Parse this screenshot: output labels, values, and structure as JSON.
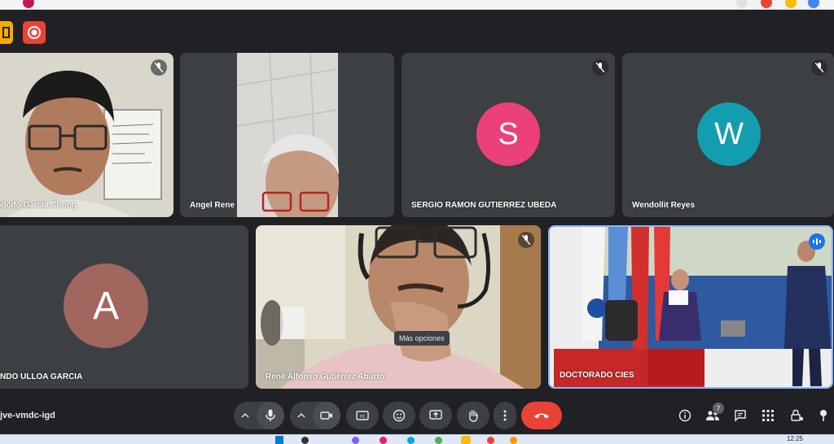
{
  "browser": {
    "url": ""
  },
  "meeting": {
    "code": "jve-vmdc-igd",
    "participant_count": "7"
  },
  "tiles": {
    "rodolfo": {
      "name": "Rodolfo García Chong"
    },
    "angel": {
      "name": "Angel Rene"
    },
    "sergio": {
      "name": "SERGIO RAMON GUTIERREZ UBEDA",
      "initial": "S",
      "avatar_color": "#ec407a"
    },
    "wendollit": {
      "name": "Wendollit Reyes",
      "initial": "W",
      "avatar_color": "#129eaf"
    },
    "ulloa": {
      "name": "NDO ULLOA GARCIA",
      "initial": "A",
      "avatar_color": "#a1665e"
    },
    "rene": {
      "name": "René Alfonso Gutiérrez Aburto"
    },
    "doctorado": {
      "name": "DOCTORADO CIES"
    }
  },
  "tooltip": {
    "text": "Más opciones"
  },
  "taskbar": {
    "time": "12:25"
  },
  "colors": {
    "tile": "#3c4043",
    "bg": "#202124",
    "accent": "#8ab4f8",
    "hangup": "#ea4335"
  }
}
